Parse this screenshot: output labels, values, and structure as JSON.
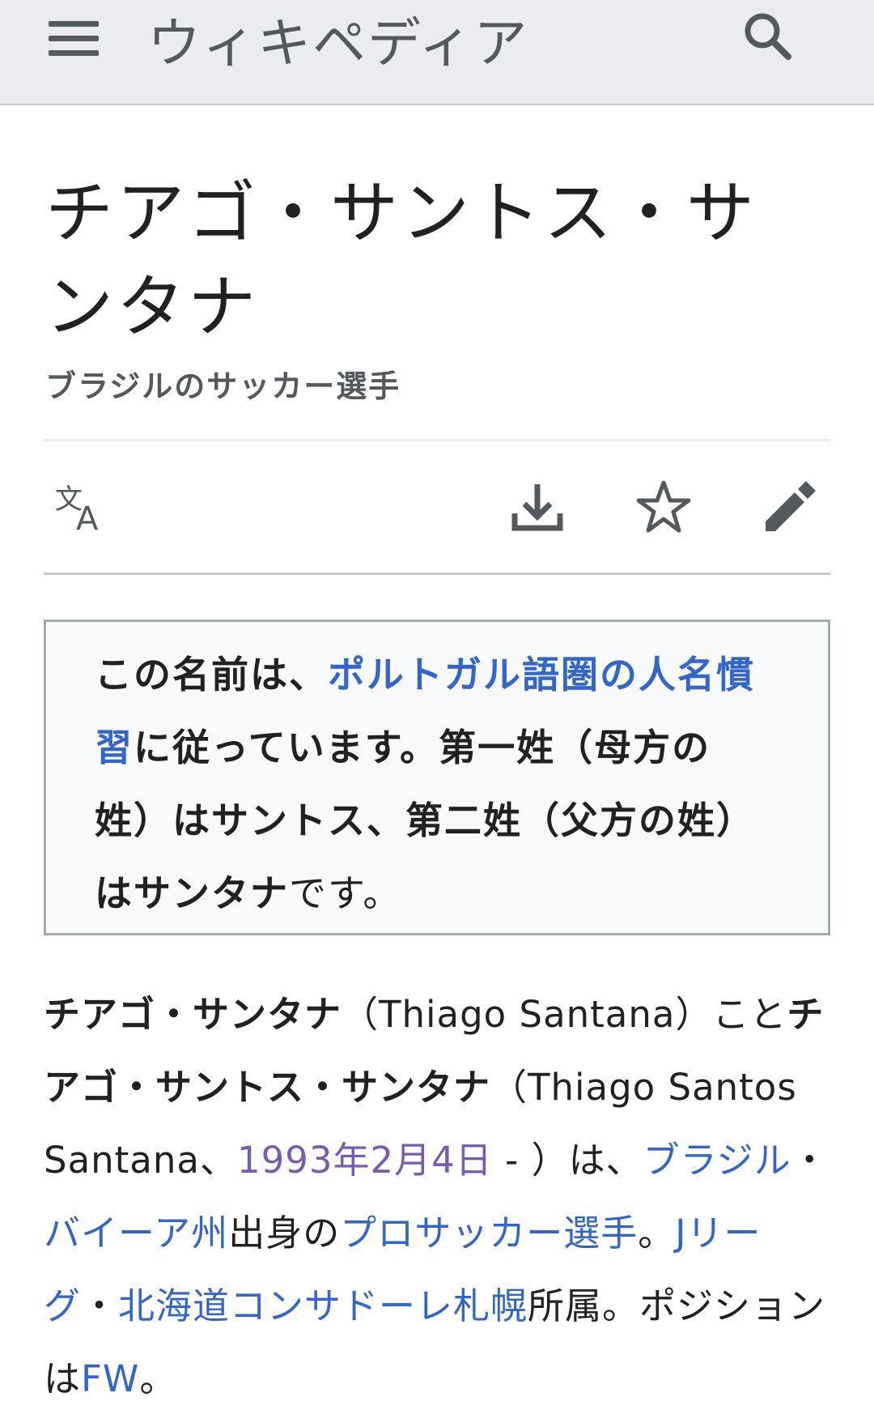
{
  "header": {
    "wordmark": "ウィキペディア",
    "menu_icon": "hamburger-menu-icon",
    "search_icon": "search-icon"
  },
  "article": {
    "title": "チアゴ・サントス・サンタナ",
    "subtitle": "ブラジルのサッカー選手"
  },
  "actions": {
    "language_icon": "language-icon",
    "download_icon": "download-icon",
    "watch_icon": "star-icon",
    "edit_icon": "pencil-icon"
  },
  "notice": {
    "part1": "この名前は、",
    "link": "ポルトガル語圏の人名慣習",
    "part2": "に従っています。第一姓（母方の姓）は",
    "name1": "サントス",
    "part3": "、第二姓（父方の姓）は",
    "name2": "サンタナ",
    "part4": "です。"
  },
  "body": {
    "bold1": "チアゴ・サンタナ",
    "t1": "（Thiago Santana）こと",
    "bold2": "チアゴ・サントス・サンタナ",
    "t2": "（Thiago Santos Santana、",
    "birth_link": "1993年2月4日",
    "t3": " - ）は、",
    "country_link": "ブラジル",
    "t4": "・",
    "state_link": "バイーア州",
    "t5": "出身の",
    "pro_link": "プロサッカー選手",
    "t6": "。",
    "league_link": "Jリーグ",
    "t7": "・",
    "club_link": "北海道コンサドーレ札幌",
    "t8": "所属。ポジションは",
    "pos_link": "FW",
    "t9": "。"
  },
  "colors": {
    "link": "#3366cc",
    "visited": "#795cb2",
    "header_bg": "#eaecf0"
  }
}
